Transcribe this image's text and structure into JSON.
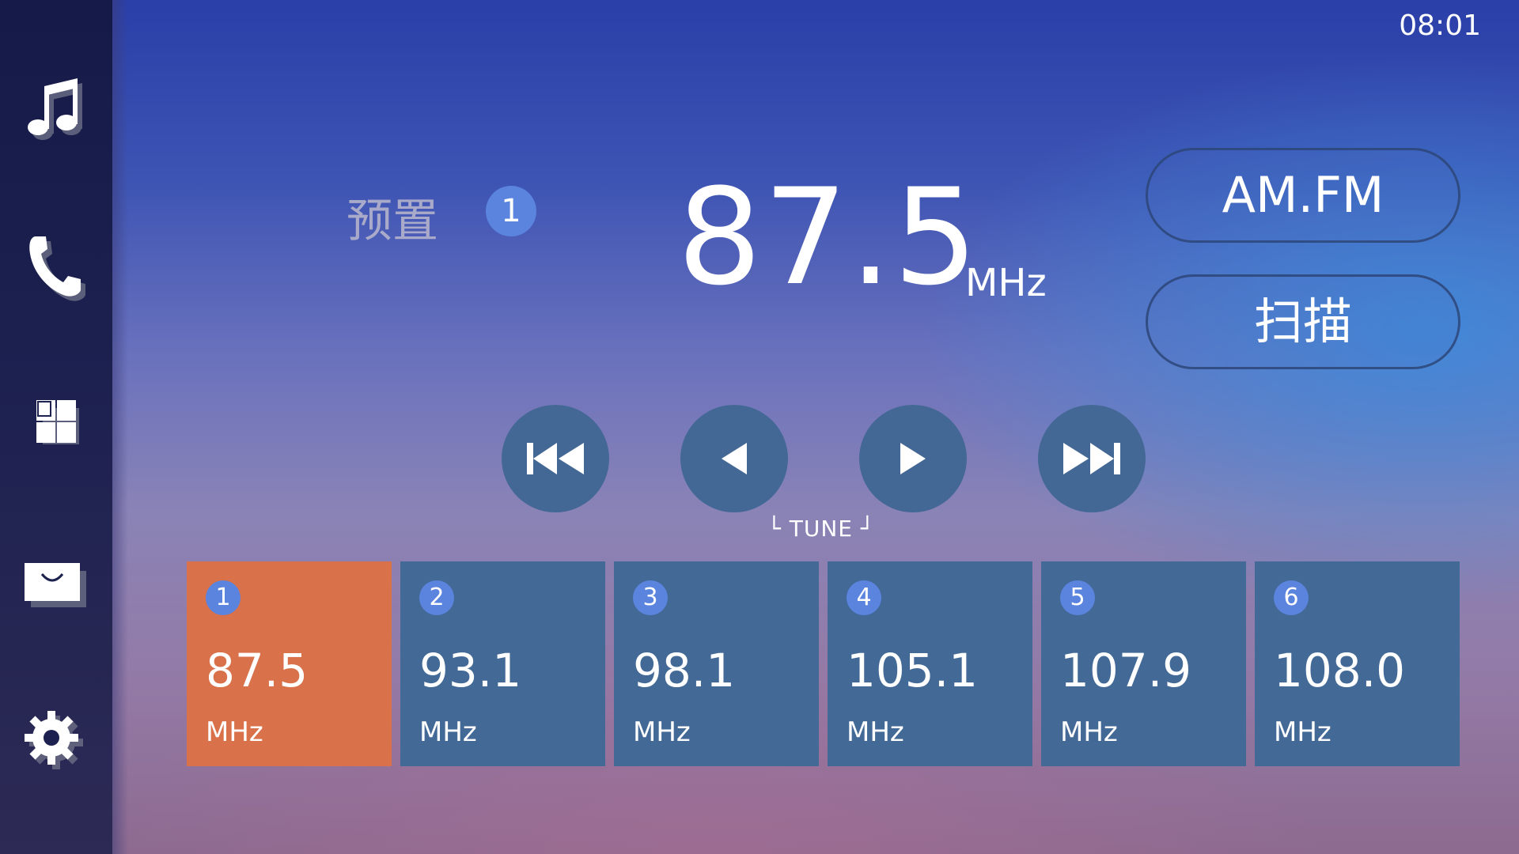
{
  "status_bar": {
    "time": "08:01"
  },
  "sidebar": {
    "items": [
      {
        "name": "music",
        "icon": "music-note-icon"
      },
      {
        "name": "phone",
        "icon": "phone-icon"
      },
      {
        "name": "apps",
        "icon": "grid-icon"
      },
      {
        "name": "media",
        "icon": "tray-icon"
      },
      {
        "name": "settings",
        "icon": "gear-icon"
      }
    ]
  },
  "tuner": {
    "preset_label": "预置",
    "preset_number": "1",
    "frequency": "87.5",
    "unit": "MHz"
  },
  "buttons": {
    "band": "AM.FM",
    "scan": "扫描"
  },
  "controls": {
    "tune_label": "└ TUNE ┘",
    "items": [
      {
        "name": "seek-back",
        "icon": "skip-back-icon"
      },
      {
        "name": "tune-down",
        "icon": "triangle-left-icon"
      },
      {
        "name": "tune-up",
        "icon": "triangle-right-icon"
      },
      {
        "name": "seek-forward",
        "icon": "skip-forward-icon"
      }
    ]
  },
  "presets": [
    {
      "number": "1",
      "frequency": "87.5",
      "unit": "MHz",
      "active": true
    },
    {
      "number": "2",
      "frequency": "93.1",
      "unit": "MHz",
      "active": false
    },
    {
      "number": "3",
      "frequency": "98.1",
      "unit": "MHz",
      "active": false
    },
    {
      "number": "4",
      "frequency": "105.1",
      "unit": "MHz",
      "active": false
    },
    {
      "number": "5",
      "frequency": "107.9",
      "unit": "MHz",
      "active": false
    },
    {
      "number": "6",
      "frequency": "108.0",
      "unit": "MHz",
      "active": false
    }
  ],
  "colors": {
    "active_preset": "#d9714a",
    "preset_tile": "#436996",
    "badge": "#5b84de",
    "control_button": "#446896",
    "sidebar": "#1d2150"
  }
}
